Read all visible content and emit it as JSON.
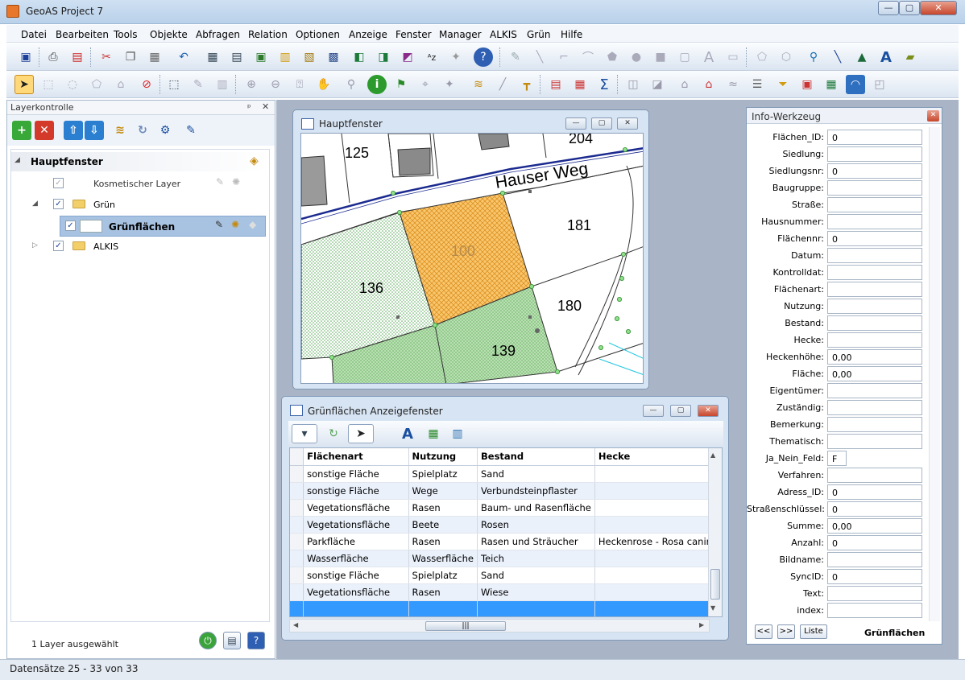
{
  "window": {
    "title": "GeoAS Project 7",
    "min": "—",
    "max": "▢",
    "close": "✕"
  },
  "menu": [
    "Datei",
    "Bearbeiten",
    "Tools",
    "Objekte",
    "Abfragen",
    "Relation",
    "Optionen",
    "Anzeige",
    "Fenster",
    "Manager",
    "ALKIS",
    "Grün",
    "Hilfe"
  ],
  "layer_panel": {
    "title": "Layerkontrolle",
    "pin": "ᵖ",
    "close": "✕",
    "root": "Hauptfenster",
    "items": [
      {
        "label": "Kosmetischer Layer"
      },
      {
        "label": "Grün"
      },
      {
        "label": "Grünflächen"
      },
      {
        "label": "ALKIS"
      }
    ],
    "status": "1 Layer ausgewählt"
  },
  "map_window": {
    "title": "Hauptfenster",
    "street": "Hauser Weg",
    "parcels": [
      "125",
      "204",
      "181",
      "100",
      "136",
      "180",
      "139"
    ],
    "colors": {
      "hatch_orange": "#f7c56a",
      "green": "#a9d8a0",
      "street_line": "#1b2a8f"
    }
  },
  "table_window": {
    "title": "Grünflächen Anzeigefenster",
    "columns": [
      "Flächenart",
      "Nutzung",
      "Bestand",
      "Hecke"
    ],
    "rows": [
      [
        "sonstige Fläche",
        "Spielplatz",
        "Sand",
        ""
      ],
      [
        "sonstige Fläche",
        "Wege",
        "Verbundsteinpflaster",
        ""
      ],
      [
        "Vegetationsfläche",
        "Rasen",
        "Baum- und Rasenfläche",
        ""
      ],
      [
        "Vegetationsfläche",
        "Beete",
        "Rosen",
        ""
      ],
      [
        "Parkfläche",
        "Rasen",
        "Rasen und Sträucher",
        "Heckenrose - Rosa canina"
      ],
      [
        "Wasserfläche",
        "Wasserfläche",
        "Teich",
        ""
      ],
      [
        "sonstige Fläche",
        "Spielplatz",
        "Sand",
        ""
      ],
      [
        "Vegetationsfläche",
        "Rasen",
        "Wiese",
        ""
      ]
    ],
    "hscroll_grip": "|||"
  },
  "info_panel": {
    "title": "Info-Werkzeug",
    "fields": [
      {
        "label": "Flächen_ID:",
        "value": "0"
      },
      {
        "label": "Siedlung:",
        "value": ""
      },
      {
        "label": "Siedlungsnr:",
        "value": "0"
      },
      {
        "label": "Baugruppe:",
        "value": ""
      },
      {
        "label": "Straße:",
        "value": ""
      },
      {
        "label": "Hausnummer:",
        "value": ""
      },
      {
        "label": "Flächennr:",
        "value": "0"
      },
      {
        "label": "Datum:",
        "value": ""
      },
      {
        "label": "Kontrolldat:",
        "value": ""
      },
      {
        "label": "Flächenart:",
        "value": ""
      },
      {
        "label": "Nutzung:",
        "value": ""
      },
      {
        "label": "Bestand:",
        "value": ""
      },
      {
        "label": "Hecke:",
        "value": ""
      },
      {
        "label": "Heckenhöhe:",
        "value": "0,00"
      },
      {
        "label": "Fläche:",
        "value": "0,00"
      },
      {
        "label": "Eigentümer:",
        "value": ""
      },
      {
        "label": "Zuständig:",
        "value": ""
      },
      {
        "label": "Bemerkung:",
        "value": ""
      },
      {
        "label": "Thematisch:",
        "value": ""
      },
      {
        "label": "Ja_Nein_Feld:",
        "value": "F"
      },
      {
        "label": "Verfahren:",
        "value": ""
      },
      {
        "label": "Adress_ID:",
        "value": "0"
      },
      {
        "label": "Straßenschlüssel:",
        "value": "0"
      },
      {
        "label": "Summe:",
        "value": "0,00"
      },
      {
        "label": "Anzahl:",
        "value": "0"
      },
      {
        "label": "Bildname:",
        "value": ""
      },
      {
        "label": "SyncID:",
        "value": "0"
      },
      {
        "label": "Text:",
        "value": ""
      },
      {
        "label": "index:",
        "value": ""
      }
    ],
    "prev": "<<",
    "next": ">>",
    "list": "Liste",
    "layer": "Grünflächen"
  },
  "status": {
    "records": "Datensätze 25 - 33 von 33"
  }
}
